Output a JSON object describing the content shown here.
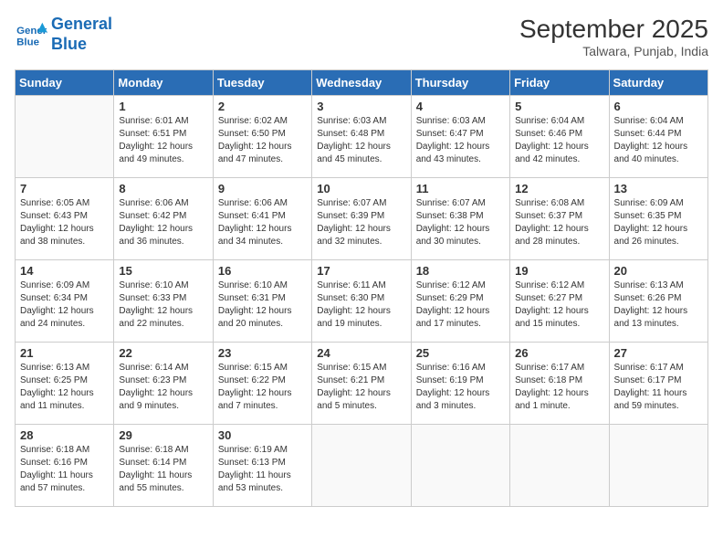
{
  "header": {
    "logo_line1": "General",
    "logo_line2": "Blue",
    "month_year": "September 2025",
    "location": "Talwara, Punjab, India"
  },
  "days_of_week": [
    "Sunday",
    "Monday",
    "Tuesday",
    "Wednesday",
    "Thursday",
    "Friday",
    "Saturday"
  ],
  "weeks": [
    [
      {
        "day": "",
        "detail": ""
      },
      {
        "day": "1",
        "detail": "Sunrise: 6:01 AM\nSunset: 6:51 PM\nDaylight: 12 hours\nand 49 minutes."
      },
      {
        "day": "2",
        "detail": "Sunrise: 6:02 AM\nSunset: 6:50 PM\nDaylight: 12 hours\nand 47 minutes."
      },
      {
        "day": "3",
        "detail": "Sunrise: 6:03 AM\nSunset: 6:48 PM\nDaylight: 12 hours\nand 45 minutes."
      },
      {
        "day": "4",
        "detail": "Sunrise: 6:03 AM\nSunset: 6:47 PM\nDaylight: 12 hours\nand 43 minutes."
      },
      {
        "day": "5",
        "detail": "Sunrise: 6:04 AM\nSunset: 6:46 PM\nDaylight: 12 hours\nand 42 minutes."
      },
      {
        "day": "6",
        "detail": "Sunrise: 6:04 AM\nSunset: 6:44 PM\nDaylight: 12 hours\nand 40 minutes."
      }
    ],
    [
      {
        "day": "7",
        "detail": "Sunrise: 6:05 AM\nSunset: 6:43 PM\nDaylight: 12 hours\nand 38 minutes."
      },
      {
        "day": "8",
        "detail": "Sunrise: 6:06 AM\nSunset: 6:42 PM\nDaylight: 12 hours\nand 36 minutes."
      },
      {
        "day": "9",
        "detail": "Sunrise: 6:06 AM\nSunset: 6:41 PM\nDaylight: 12 hours\nand 34 minutes."
      },
      {
        "day": "10",
        "detail": "Sunrise: 6:07 AM\nSunset: 6:39 PM\nDaylight: 12 hours\nand 32 minutes."
      },
      {
        "day": "11",
        "detail": "Sunrise: 6:07 AM\nSunset: 6:38 PM\nDaylight: 12 hours\nand 30 minutes."
      },
      {
        "day": "12",
        "detail": "Sunrise: 6:08 AM\nSunset: 6:37 PM\nDaylight: 12 hours\nand 28 minutes."
      },
      {
        "day": "13",
        "detail": "Sunrise: 6:09 AM\nSunset: 6:35 PM\nDaylight: 12 hours\nand 26 minutes."
      }
    ],
    [
      {
        "day": "14",
        "detail": "Sunrise: 6:09 AM\nSunset: 6:34 PM\nDaylight: 12 hours\nand 24 minutes."
      },
      {
        "day": "15",
        "detail": "Sunrise: 6:10 AM\nSunset: 6:33 PM\nDaylight: 12 hours\nand 22 minutes."
      },
      {
        "day": "16",
        "detail": "Sunrise: 6:10 AM\nSunset: 6:31 PM\nDaylight: 12 hours\nand 20 minutes."
      },
      {
        "day": "17",
        "detail": "Sunrise: 6:11 AM\nSunset: 6:30 PM\nDaylight: 12 hours\nand 19 minutes."
      },
      {
        "day": "18",
        "detail": "Sunrise: 6:12 AM\nSunset: 6:29 PM\nDaylight: 12 hours\nand 17 minutes."
      },
      {
        "day": "19",
        "detail": "Sunrise: 6:12 AM\nSunset: 6:27 PM\nDaylight: 12 hours\nand 15 minutes."
      },
      {
        "day": "20",
        "detail": "Sunrise: 6:13 AM\nSunset: 6:26 PM\nDaylight: 12 hours\nand 13 minutes."
      }
    ],
    [
      {
        "day": "21",
        "detail": "Sunrise: 6:13 AM\nSunset: 6:25 PM\nDaylight: 12 hours\nand 11 minutes."
      },
      {
        "day": "22",
        "detail": "Sunrise: 6:14 AM\nSunset: 6:23 PM\nDaylight: 12 hours\nand 9 minutes."
      },
      {
        "day": "23",
        "detail": "Sunrise: 6:15 AM\nSunset: 6:22 PM\nDaylight: 12 hours\nand 7 minutes."
      },
      {
        "day": "24",
        "detail": "Sunrise: 6:15 AM\nSunset: 6:21 PM\nDaylight: 12 hours\nand 5 minutes."
      },
      {
        "day": "25",
        "detail": "Sunrise: 6:16 AM\nSunset: 6:19 PM\nDaylight: 12 hours\nand 3 minutes."
      },
      {
        "day": "26",
        "detail": "Sunrise: 6:17 AM\nSunset: 6:18 PM\nDaylight: 12 hours\nand 1 minute."
      },
      {
        "day": "27",
        "detail": "Sunrise: 6:17 AM\nSunset: 6:17 PM\nDaylight: 11 hours\nand 59 minutes."
      }
    ],
    [
      {
        "day": "28",
        "detail": "Sunrise: 6:18 AM\nSunset: 6:16 PM\nDaylight: 11 hours\nand 57 minutes."
      },
      {
        "day": "29",
        "detail": "Sunrise: 6:18 AM\nSunset: 6:14 PM\nDaylight: 11 hours\nand 55 minutes."
      },
      {
        "day": "30",
        "detail": "Sunrise: 6:19 AM\nSunset: 6:13 PM\nDaylight: 11 hours\nand 53 minutes."
      },
      {
        "day": "",
        "detail": ""
      },
      {
        "day": "",
        "detail": ""
      },
      {
        "day": "",
        "detail": ""
      },
      {
        "day": "",
        "detail": ""
      }
    ]
  ]
}
